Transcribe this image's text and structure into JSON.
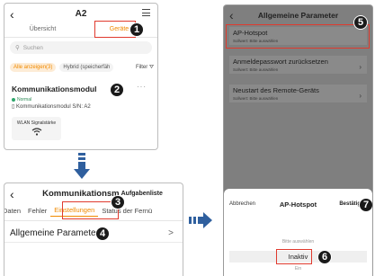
{
  "screen1": {
    "title": "A2",
    "tabs": [
      "Übersicht",
      "Geräte"
    ],
    "search_placeholder": "Suchen",
    "filters": [
      "Alle anzeigen(3)",
      "Hybrid (speicherfäh",
      "Filter"
    ],
    "module_title": "Kommunikationsmodul",
    "more": "···",
    "status": "Normal",
    "serial": "Kommunikationsmodul S/N: A2",
    "wlan_label": "WLAN Signalstärke"
  },
  "screen2": {
    "title": "Kommunikationsm",
    "action": "Aufgabenliste",
    "tabs": [
      "Daten",
      "Fehler",
      "Einstellungen",
      "Status der Fernü"
    ],
    "row_label": "Allgemeine Parameter",
    "chevron": ">"
  },
  "screen3": {
    "title": "Allgemeine Parameter",
    "items": [
      {
        "title": "AP-Hotspot",
        "sub": "Sollwert: Bitte auswählen"
      },
      {
        "title": "Anmeldepasswort zurücksetzen",
        "sub": "Sollwert: Bitte auswählen"
      },
      {
        "title": "Neustart des Remote-Geräts",
        "sub": "Sollwert: Bitte auswählen"
      }
    ],
    "sheet": {
      "cancel": "Abbrechen",
      "title": "AP-Hotspot",
      "confirm": "Bestätigen",
      "options": [
        "Bitte auswählen",
        "Inaktiv",
        "Ein"
      ]
    }
  },
  "steps": [
    "1",
    "2",
    "3",
    "4",
    "5",
    "6",
    "7"
  ],
  "colors": {
    "accent": "#f08a00",
    "highlight": "#e03a2e",
    "badge": "#1a1a1a",
    "status_green": "#2ea66b",
    "arrow": "#2f5f9e"
  }
}
